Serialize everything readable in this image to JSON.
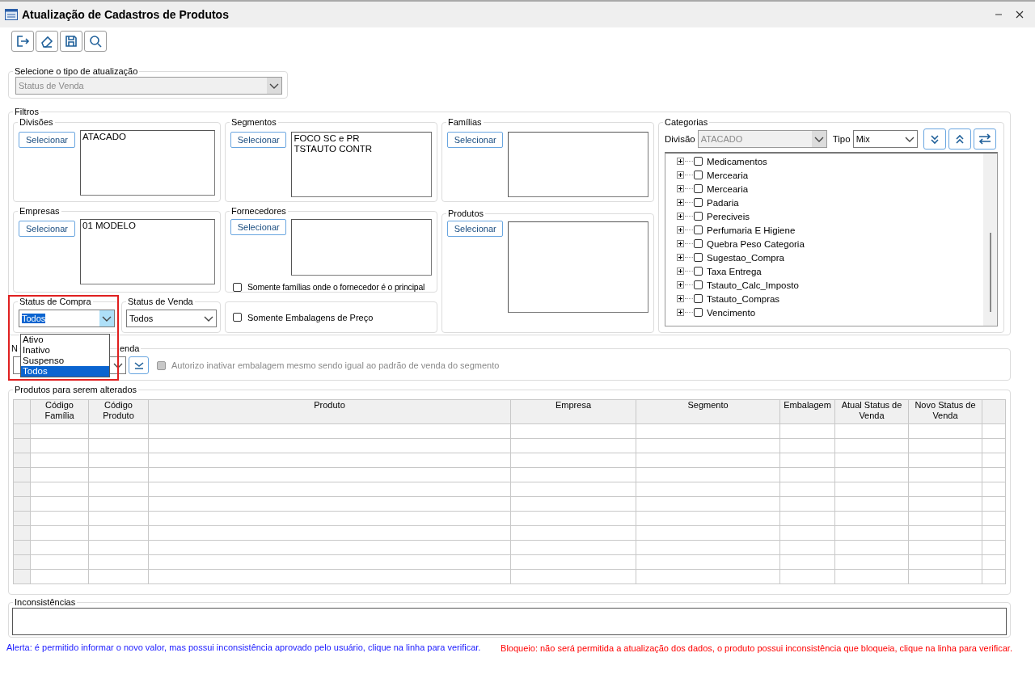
{
  "window": {
    "title": "Atualização de Cadastros de Produtos"
  },
  "update_type": {
    "label": "Selecione o tipo de atualização",
    "value": "Status de Venda",
    "disabled": true
  },
  "filters": {
    "label": "Filtros",
    "divisions": {
      "label": "Divisões",
      "button": "Selecionar",
      "items": [
        "ATACADO"
      ]
    },
    "segments": {
      "label": "Segmentos",
      "button": "Selecionar",
      "items": [
        "FOCO SC e PR",
        "TSTAUTO CONTR"
      ]
    },
    "families": {
      "label": "Famílias",
      "button": "Selecionar"
    },
    "companies": {
      "label": "Empresas",
      "button": "Selecionar",
      "items": [
        "01 MODELO"
      ]
    },
    "suppliers": {
      "label": "Fornecedores",
      "button": "Selecionar",
      "option": {
        "label": "Somente famílias onde o fornecedor é o principal",
        "checked": false
      }
    },
    "products": {
      "label": "Produtos",
      "button": "Selecionar"
    },
    "purchase_status": {
      "label": "Status de Compra",
      "value": "Todos",
      "expanded": true,
      "highlighted": true,
      "options": [
        {
          "label": "Ativo",
          "selected": false
        },
        {
          "label": "Inativo",
          "selected": false
        },
        {
          "label": "Suspenso",
          "selected": false
        },
        {
          "label": "Todos",
          "selected": true
        }
      ]
    },
    "sale_status": {
      "label": "Status de Venda",
      "value": "Todos"
    },
    "price_packaging": {
      "label": "Somente Embalagens de Preço",
      "checked": false
    },
    "categories": {
      "label": "Categorias",
      "division_label": "Divisão",
      "division": "ATACADO",
      "division_disabled": true,
      "type_label": "Tipo",
      "type": "Mix",
      "items": [
        {
          "label": "Medicamentos",
          "checked": false,
          "expanded": false
        },
        {
          "label": "Mercearia",
          "checked": false,
          "expanded": false
        },
        {
          "label": "Mercearia",
          "checked": false,
          "expanded": false
        },
        {
          "label": "Padaria",
          "checked": false,
          "expanded": false
        },
        {
          "label": "Pereciveis",
          "checked": false,
          "expanded": false
        },
        {
          "label": "Perfumaria E Higiene",
          "checked": false,
          "expanded": false
        },
        {
          "label": "Quebra Peso Categoria",
          "checked": false,
          "expanded": false
        },
        {
          "label": "Sugestao_Compra",
          "checked": false,
          "expanded": false
        },
        {
          "label": "Taxa Entrega",
          "checked": false,
          "expanded": false
        },
        {
          "label": "Tstauto_Calc_Imposto",
          "checked": false,
          "expanded": false
        },
        {
          "label": "Tstauto_Compras",
          "checked": false,
          "expanded": false
        },
        {
          "label": "Vencimento",
          "checked": false,
          "expanded": false
        }
      ]
    }
  },
  "new_status": {
    "label_start": "N",
    "label_end": "enda",
    "authorize": {
      "label": "Autorizo inativar embalagem mesmo sendo igual ao padrão de venda do segmento",
      "checked": false,
      "disabled": true
    }
  },
  "table": {
    "label": "Produtos para serem alterados",
    "columns": [
      "Código Família",
      "Código Produto",
      "Produto",
      "Empresa",
      "Segmento",
      "Embalagem",
      "Atual Status de Venda",
      "Novo Status de Venda"
    ]
  },
  "inconsistencies": {
    "label": "Inconsistências"
  },
  "footer": {
    "alert": "Alerta: é permitido informar o novo valor, mas possui inconsistência aprovado pelo usuário, clique na linha para verificar.",
    "block": "Bloqueio: não será permitida a atualização dos dados, o produto possui inconsistência que bloqueia, clique na linha para verificar."
  }
}
